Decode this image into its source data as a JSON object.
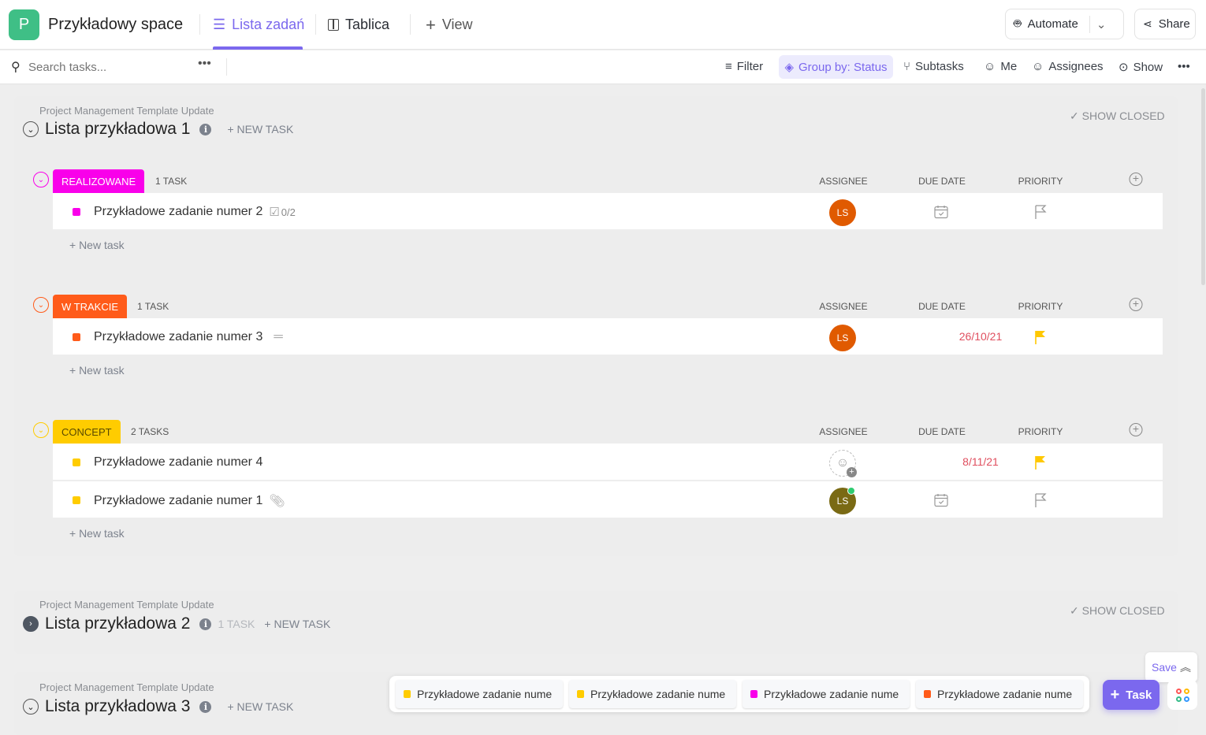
{
  "header": {
    "space_initial": "P",
    "space_name": "Przykładowy space",
    "tabs": [
      {
        "label": "Lista zadań",
        "icon": "list-icon",
        "active": true
      },
      {
        "label": "Tablica",
        "icon": "board-icon"
      },
      {
        "label": "View",
        "icon": "plus-icon"
      }
    ],
    "automate": "Automate",
    "share": "Share"
  },
  "toolbar": {
    "search_placeholder": "Search tasks...",
    "filter": "Filter",
    "group_by": "Group by: Status",
    "subtasks": "Subtasks",
    "me": "Me",
    "assignees": "Assignees",
    "show": "Show"
  },
  "colors": {
    "accent": "#7b68ee",
    "realizowane": "#f900ea",
    "w_trakcie": "#ff5b1a",
    "concept": "#ffcc00",
    "avatar": "#e05a00",
    "avatar2": "#7a6a14"
  },
  "lists": [
    {
      "project": "Project Management Template Update",
      "title": "Lista przykładowa 1",
      "new_task": "+ NEW TASK",
      "show_closed": "SHOW CLOSED",
      "groups": [
        {
          "status": "REALIZOWANE",
          "color": "#f900ea",
          "count": "1 TASK",
          "col_assignee": "ASSIGNEE",
          "col_due": "DUE DATE",
          "col_priority": "PRIORITY",
          "new_task": "+ New task",
          "tasks": [
            {
              "name": "Przykładowe zadanie numer 2",
              "extra": "checklist",
              "checklist": "0/2",
              "assignee": "LS",
              "assignee_color": "#e05a00",
              "due": "",
              "priority": "none"
            }
          ]
        },
        {
          "status": "W TRAKCIE",
          "color": "#ff5b1a",
          "count": "1 TASK",
          "col_assignee": "ASSIGNEE",
          "col_due": "DUE DATE",
          "col_priority": "PRIORITY",
          "new_task": "+ New task",
          "tasks": [
            {
              "name": "Przykładowe zadanie numer 3",
              "extra": "description",
              "assignee": "LS",
              "assignee_color": "#e05a00",
              "due": "26/10/21",
              "priority": "high"
            }
          ]
        },
        {
          "status": "CONCEPT",
          "color": "#ffcc00",
          "count": "2 TASKS",
          "col_assignee": "ASSIGNEE",
          "col_due": "DUE DATE",
          "col_priority": "PRIORITY",
          "new_task": "+ New task",
          "tasks": [
            {
              "name": "Przykładowe zadanie numer 4",
              "extra": "",
              "assignee": "",
              "due": "8/11/21",
              "priority": "high"
            },
            {
              "name": "Przykładowe zadanie numer 1",
              "extra": "attachment",
              "assignee": "LS",
              "assignee_color": "#7a6a14",
              "online": true,
              "due": "",
              "priority": "none"
            }
          ]
        }
      ]
    },
    {
      "project": "Project Management Template Update",
      "title": "Lista przykładowa 2",
      "count": "1 TASK",
      "new_task": "+ NEW TASK",
      "show_closed": "SHOW CLOSED",
      "collapsed": true
    },
    {
      "project": "Project Management Template Update",
      "title": "Lista przykładowa 3",
      "new_task": "+ NEW TASK"
    }
  ],
  "tray": [
    {
      "name": "Przykładowe zadanie nume",
      "color": "#ffcc00"
    },
    {
      "name": "Przykładowe zadanie nume",
      "color": "#ffcc00"
    },
    {
      "name": "Przykładowe zadanie nume",
      "color": "#f900ea"
    },
    {
      "name": "Przykładowe zadanie nume",
      "color": "#ff5b1a"
    }
  ],
  "save": "Save",
  "add_task": "Task"
}
